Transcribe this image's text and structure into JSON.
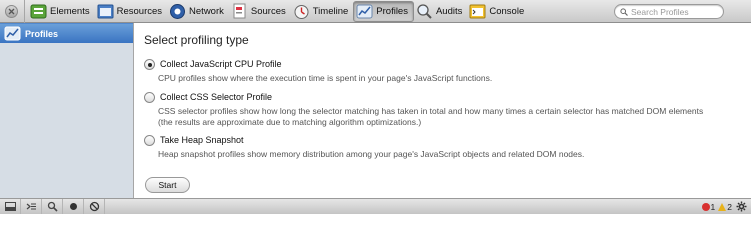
{
  "toolbar": {
    "tabs": [
      {
        "label": "Elements",
        "icon": "elements-icon"
      },
      {
        "label": "Resources",
        "icon": "resources-icon"
      },
      {
        "label": "Network",
        "icon": "network-icon"
      },
      {
        "label": "Sources",
        "icon": "sources-icon"
      },
      {
        "label": "Timeline",
        "icon": "timeline-icon"
      },
      {
        "label": "Profiles",
        "icon": "profiles-icon",
        "selected": true
      },
      {
        "label": "Audits",
        "icon": "audits-icon"
      },
      {
        "label": "Console",
        "icon": "console-icon"
      }
    ],
    "search_placeholder": "Search Profiles"
  },
  "sidebar": {
    "items": [
      {
        "label": "Profiles",
        "icon": "profiles-icon",
        "selected": true
      }
    ]
  },
  "main": {
    "heading": "Select profiling type",
    "options": [
      {
        "title": "Collect JavaScript CPU Profile",
        "desc": [
          "CPU profiles show where the execution time is spent in your page's JavaScript functions."
        ],
        "checked": true
      },
      {
        "title": "Collect CSS Selector Profile",
        "desc": [
          "CSS selector profiles show how long the selector matching has taken in total and how many times a certain selector has matched DOM elements",
          "(the results are approximate due to matching algorithm optimizations.)"
        ],
        "checked": false
      },
      {
        "title": "Take Heap Snapshot",
        "desc": [
          "Heap snapshot profiles show memory distribution among your page's JavaScript objects and related DOM nodes."
        ],
        "checked": false
      }
    ],
    "start_label": "Start"
  },
  "statusbar": {
    "error_count": "1",
    "warning_count": "2"
  },
  "colors": {
    "sidebar_bg": "#d6dde5",
    "selection": "#3a74c2",
    "error": "#d8302f",
    "warning": "#e8b21a"
  }
}
